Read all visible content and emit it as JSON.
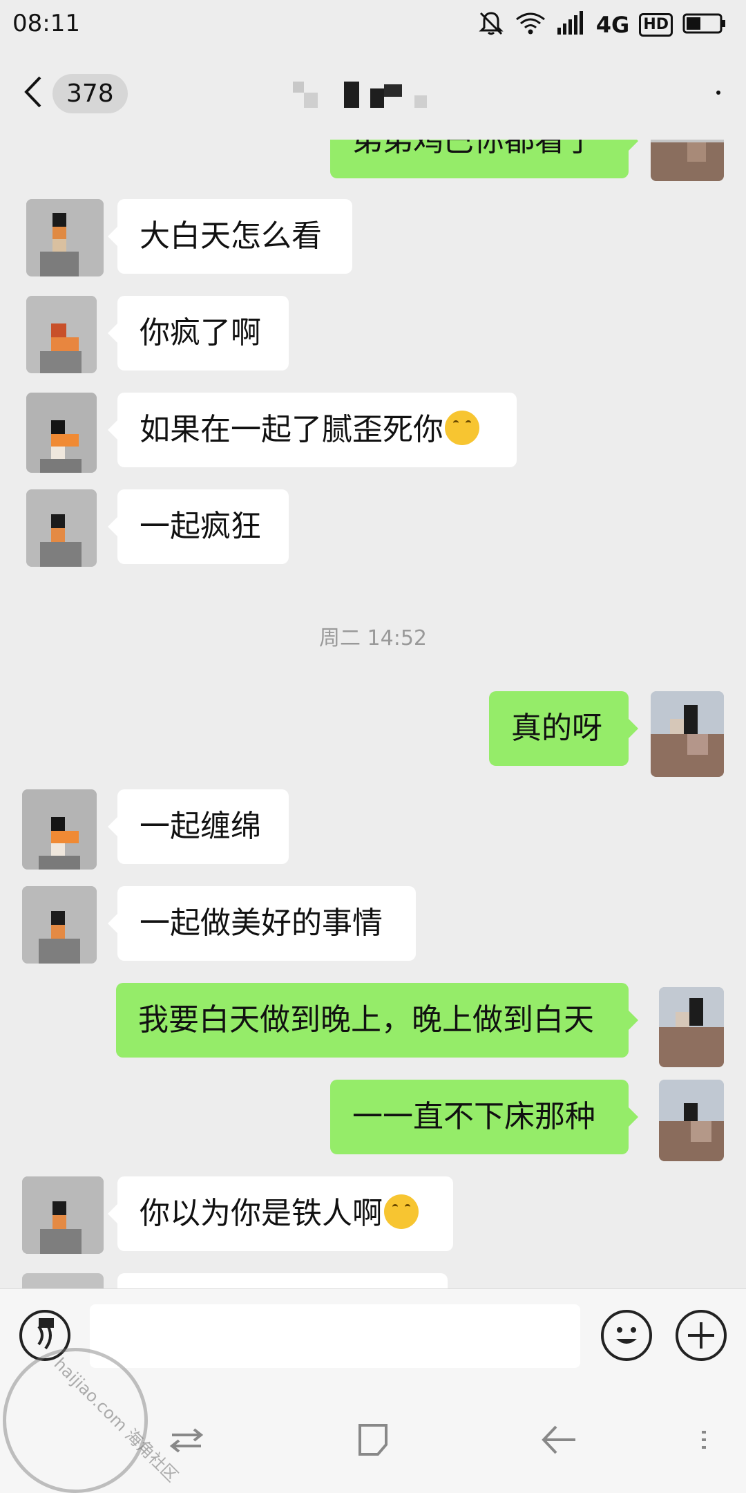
{
  "status_bar": {
    "time": "08:11",
    "network": "4G",
    "hd_label": "HD",
    "icons": [
      "notifications-off-icon",
      "wifi-icon",
      "signal-icon",
      "battery-icon"
    ]
  },
  "header": {
    "back_icon": "chevron-left-icon",
    "unread_count": "378",
    "more_icon": "more-icon"
  },
  "messages": [
    {
      "side": "out",
      "text": "弟弟鸡巴你都看了",
      "partial": true
    },
    {
      "side": "in",
      "text": "大白天怎么看"
    },
    {
      "side": "in",
      "text": "你疯了啊"
    },
    {
      "side": "in",
      "text": "如果在一起了腻歪死你",
      "emoji": "thinking-face"
    },
    {
      "side": "in",
      "text": "一起疯狂"
    },
    {
      "type": "time",
      "text": "周二 14:52"
    },
    {
      "side": "out",
      "text": "真的呀"
    },
    {
      "side": "in",
      "text": "一起缠绵"
    },
    {
      "side": "in",
      "text": "一起做美好的事情"
    },
    {
      "side": "out",
      "text": "我要白天做到晚上，晚上做到白天"
    },
    {
      "side": "out",
      "text": "一一直不下床那种"
    },
    {
      "side": "in",
      "text": "你以为你是铁人啊",
      "emoji": "thinking-face"
    }
  ],
  "input_bar": {
    "voice_icon": "voice-icon",
    "emoji_icon": "emoji-icon",
    "plus_icon": "plus-icon",
    "input_value": ""
  },
  "nav_bar": {
    "icons": [
      "switch-icon",
      "home-square-icon",
      "back-arrow-icon",
      "menu-icon"
    ]
  },
  "watermark": {
    "text": "haijiao.com 海角社区"
  },
  "colors": {
    "background": "#ededed",
    "bubble_out": "#95ec69",
    "bubble_in": "#ffffff",
    "timestamp": "#999999"
  }
}
